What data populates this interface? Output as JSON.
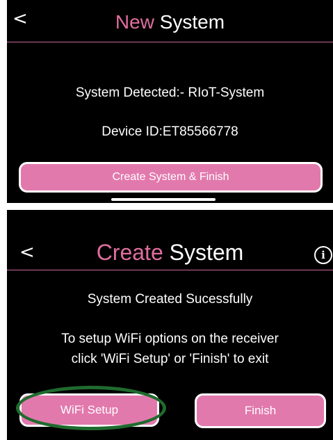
{
  "top_screen": {
    "back_glyph": "<",
    "title_accent": "New",
    "title_rest": " System",
    "system_detected": "System Detected:- RIoT-System",
    "device_id": "Device ID:ET85566778",
    "create_finish_label": "Create System & Finish"
  },
  "bottom_screen": {
    "back_glyph": "<",
    "title_accent": "Create",
    "title_rest": " System",
    "info_glyph": "i",
    "success_message": "System Created Sucessfully",
    "instruction_line1": "To setup WiFi options on the receiver",
    "instruction_line2": "click 'WiFi Setup' or 'Finish' to exit",
    "wifi_setup_label": "WiFi Setup",
    "finish_label": "Finish"
  },
  "colors": {
    "accent": "#e06e9f",
    "button_fill": "#e279ad",
    "highlight_ring": "#1f6b2e",
    "background": "#000000"
  },
  "icons": {
    "back": "chevron-left-icon",
    "info": "info-circle-icon"
  }
}
